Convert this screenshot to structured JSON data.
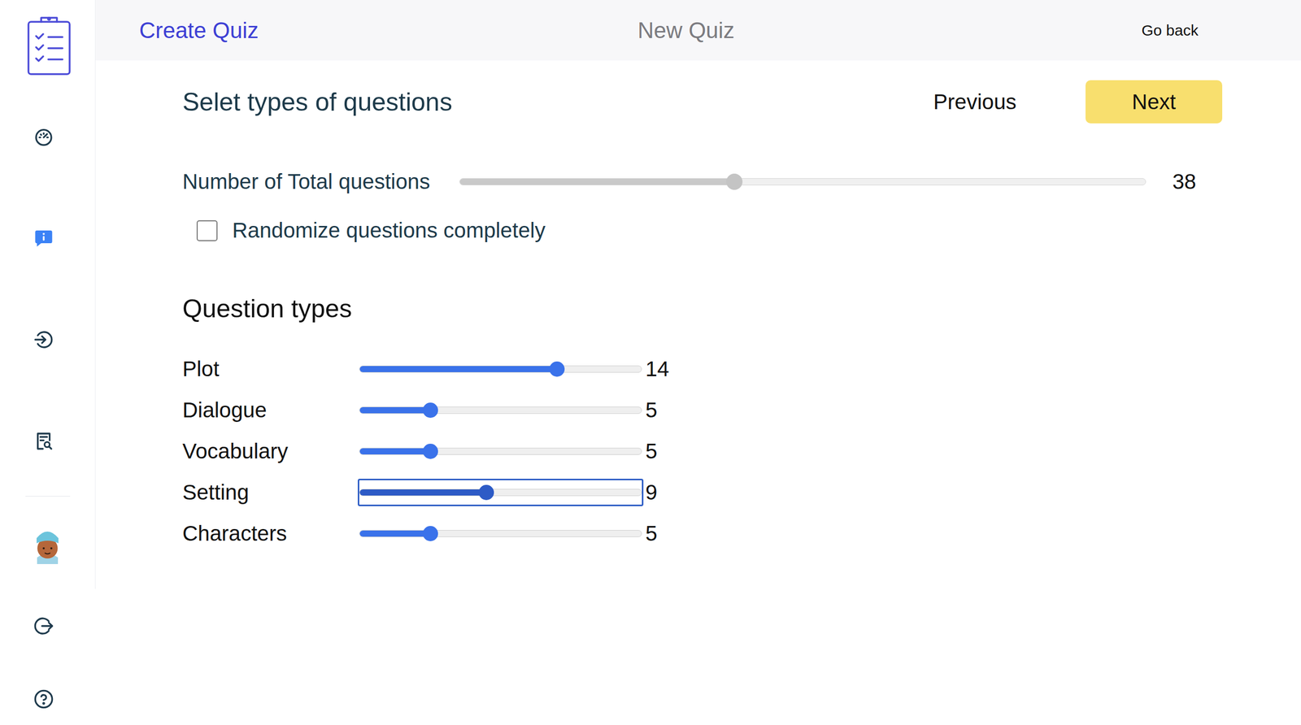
{
  "header": {
    "title": "Create Quiz",
    "subtitle": "New Quiz",
    "back": "Go back"
  },
  "sidebar": {
    "items": [
      {
        "selected": false
      },
      {
        "selected": true
      },
      {
        "selected": false
      },
      {
        "selected": false
      }
    ]
  },
  "step": {
    "title": "Selet types of questions",
    "previous": "Previous",
    "next": "Next"
  },
  "total": {
    "label": "Number of Total questions",
    "level": 0.4,
    "reading": "38"
  },
  "randomize": {
    "label": "Randomize questions completely",
    "checked": false
  },
  "question_types": {
    "title": "Question types",
    "items": [
      {
        "label": "Plot",
        "level": 0.7,
        "reading": "14",
        "focused": false
      },
      {
        "label": "Dialogue",
        "level": 0.25,
        "reading": "5",
        "focused": false
      },
      {
        "label": "Vocabulary",
        "level": 0.25,
        "reading": "5",
        "focused": false
      },
      {
        "label": "Setting",
        "level": 0.45,
        "reading": "9",
        "focused": true
      },
      {
        "label": "Characters",
        "level": 0.25,
        "reading": "5",
        "focused": false
      }
    ]
  }
}
